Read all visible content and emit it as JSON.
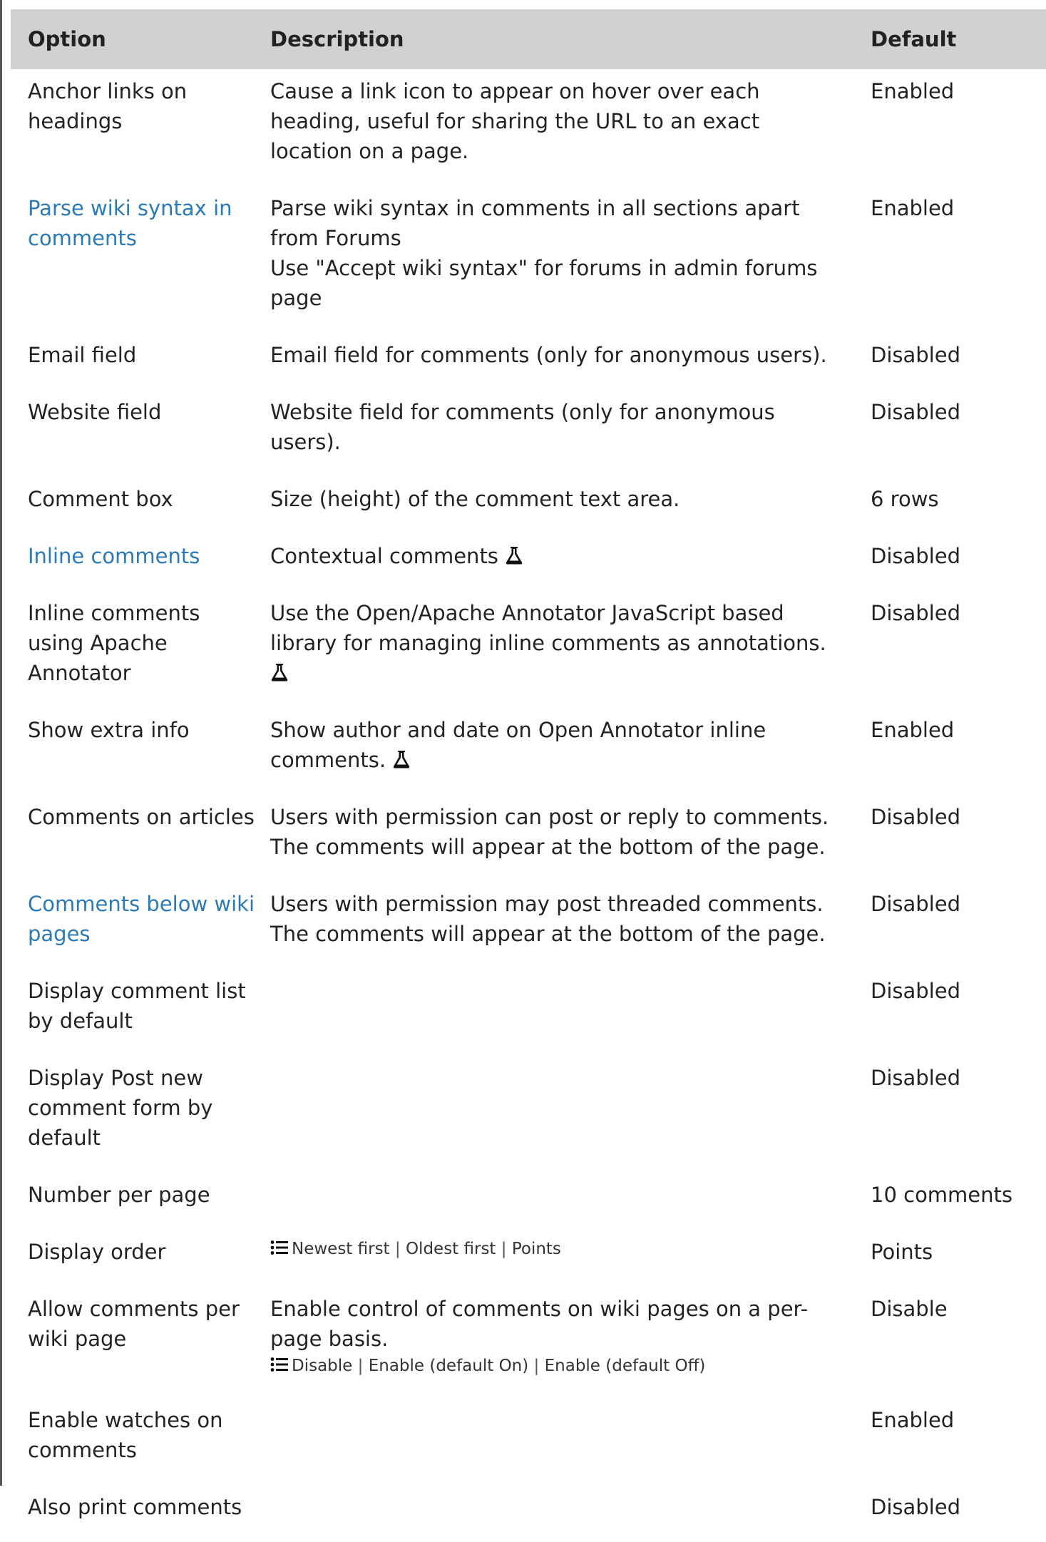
{
  "header": {
    "option": "Option",
    "description": "Description",
    "default": "Default"
  },
  "rows": [
    {
      "option": "Anchor links on headings",
      "is_link": false,
      "description": [
        "Cause a link icon to appear on hover over each heading, useful for sharing the URL to an exact location on a page."
      ],
      "flask": false,
      "options": null,
      "default": "Enabled"
    },
    {
      "option": "Parse wiki syntax in comments",
      "is_link": true,
      "description": [
        "Parse wiki syntax in comments in all sections apart from Forums",
        "Use \"Accept wiki syntax\" for forums in admin forums page"
      ],
      "flask": false,
      "options": null,
      "default": "Enabled"
    },
    {
      "option": "Email field",
      "is_link": false,
      "description": [
        "Email field for comments (only for anonymous users)."
      ],
      "flask": false,
      "options": null,
      "default": "Disabled"
    },
    {
      "option": "Website field",
      "is_link": false,
      "description": [
        "Website field for comments (only for anonymous users)."
      ],
      "flask": false,
      "options": null,
      "default": "Disabled"
    },
    {
      "option": "Comment box",
      "is_link": false,
      "description": [
        "Size (height) of the comment text area."
      ],
      "flask": false,
      "options": null,
      "default": "6 rows"
    },
    {
      "option": "Inline comments",
      "is_link": true,
      "description": [
        "Contextual comments"
      ],
      "flask": true,
      "options": null,
      "default": "Disabled"
    },
    {
      "option": "Inline comments using Apache Annotator",
      "is_link": false,
      "description": [
        "Use the Open/Apache Annotator JavaScript based library for managing inline comments as annotations."
      ],
      "flask": true,
      "options": null,
      "default": "Disabled"
    },
    {
      "option": "Show extra info",
      "is_link": false,
      "description": [
        "Show author and date on Open Annotator inline comments."
      ],
      "flask": true,
      "options": null,
      "default": "Enabled"
    },
    {
      "option": "Comments on articles",
      "is_link": false,
      "description": [
        "Users with permission can post or reply to comments. The comments will appear at the bottom of the page."
      ],
      "flask": false,
      "options": null,
      "default": "Disabled"
    },
    {
      "option": "Comments below wiki pages",
      "is_link": true,
      "description": [
        "Users with permission may post threaded comments. The comments will appear at the bottom of the page."
      ],
      "flask": false,
      "options": null,
      "default": "Disabled"
    },
    {
      "option": "Display comment list by default",
      "is_link": false,
      "description": [],
      "flask": false,
      "options": null,
      "default": "Disabled"
    },
    {
      "option": "Display Post new comment form by default",
      "is_link": false,
      "description": [],
      "flask": false,
      "options": null,
      "default": "Disabled"
    },
    {
      "option": "Number per page",
      "is_link": false,
      "description": [],
      "flask": false,
      "options": null,
      "default": "10 comments"
    },
    {
      "option": "Display order",
      "is_link": false,
      "description": [],
      "flask": false,
      "options": [
        "Newest first",
        "Oldest first",
        "Points"
      ],
      "default": "Points"
    },
    {
      "option": "Allow comments per wiki page",
      "is_link": false,
      "description": [
        "Enable control of comments on wiki pages on a per-page basis."
      ],
      "flask": false,
      "options": [
        "Disable",
        "Enable (default On)",
        "Enable (default Off)"
      ],
      "default": "Disable"
    },
    {
      "option": "Enable watches on comments",
      "is_link": false,
      "description": [],
      "flask": false,
      "options": null,
      "default": "Enabled"
    },
    {
      "option": "Also print comments",
      "is_link": false,
      "description": [],
      "flask": false,
      "options": null,
      "default": "Disabled"
    }
  ],
  "icons": {
    "flask": "flask-icon",
    "list": "list-icon"
  },
  "colors": {
    "header_bg": "#d1d1d1",
    "link": "#2a7ab8",
    "text": "#222222"
  }
}
